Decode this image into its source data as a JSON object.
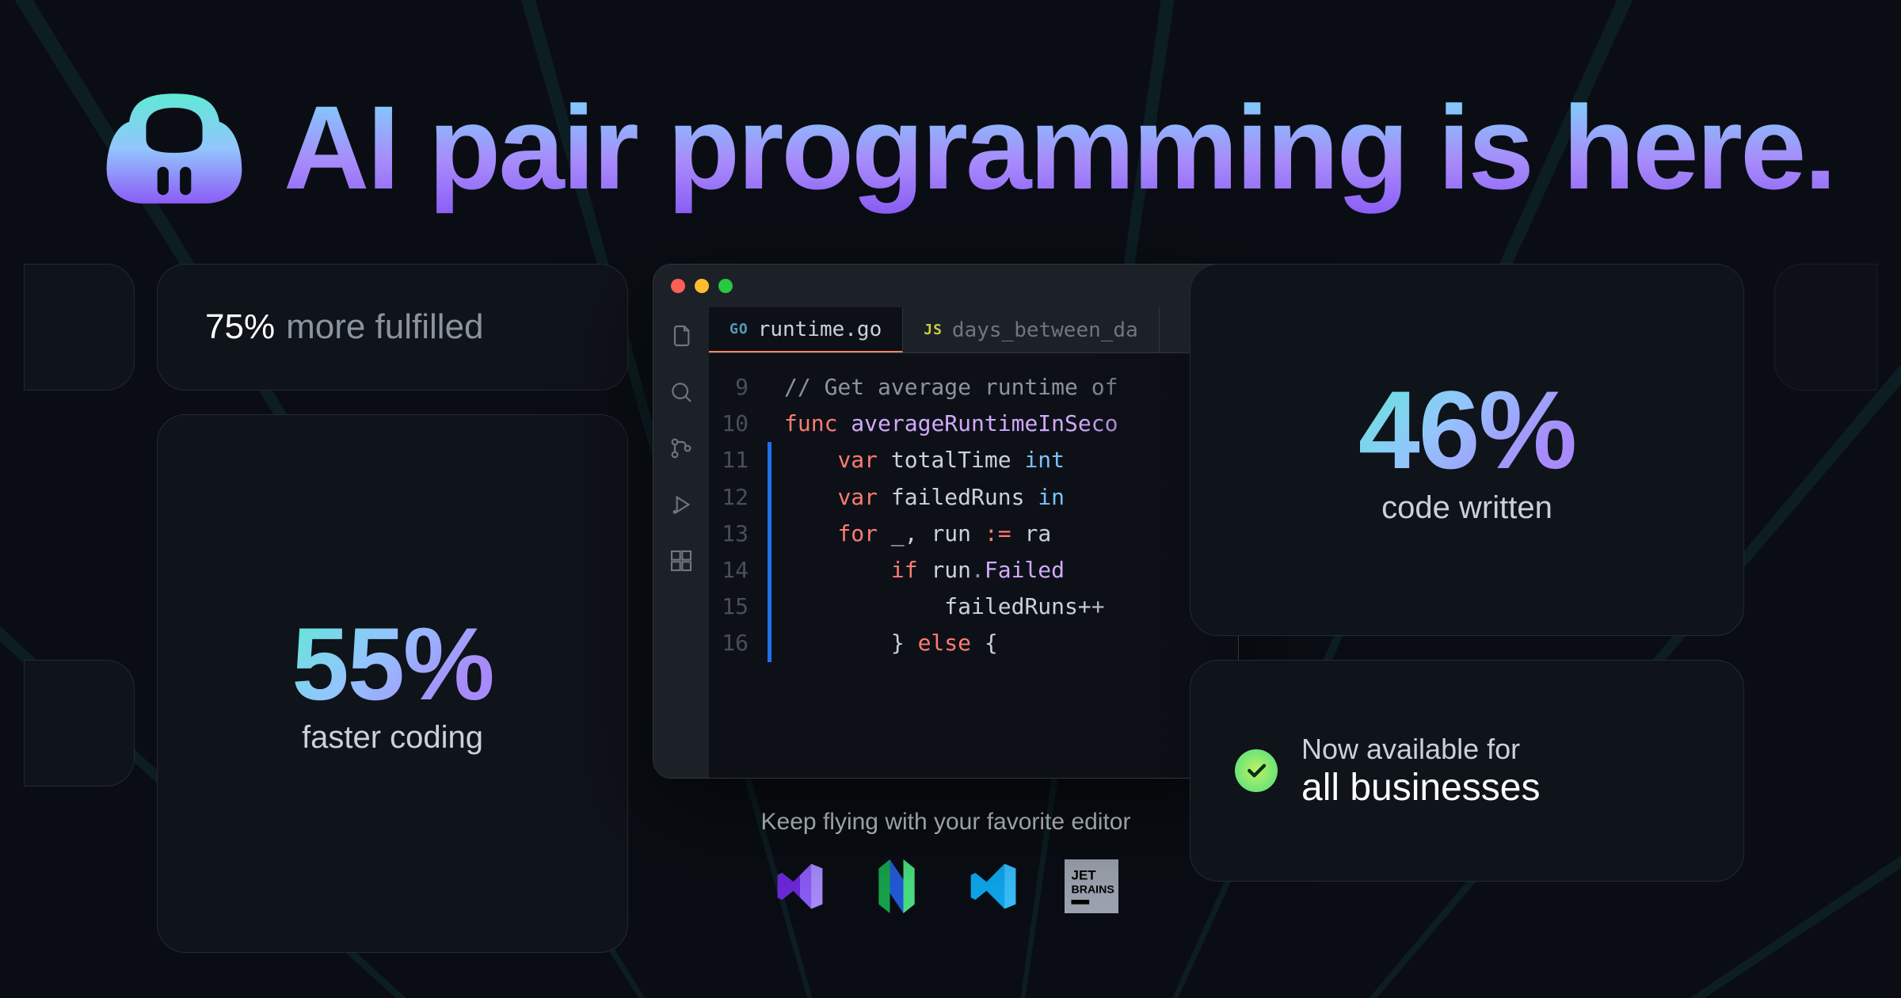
{
  "hero": {
    "title": "AI pair programming is here."
  },
  "cards": {
    "fulfilled": {
      "percent": "75%",
      "label": "more fulfilled"
    },
    "faster": {
      "percent": "55%",
      "label": "faster coding"
    },
    "code_written": {
      "percent": "46%",
      "label": "code written"
    },
    "available": {
      "line1": "Now available for",
      "line2": "all businesses"
    }
  },
  "editor": {
    "tabs": [
      {
        "lang": "GO",
        "name": "runtime.go",
        "active": true
      },
      {
        "lang": "JS",
        "name": "days_between_da",
        "active": false
      }
    ],
    "lines": [
      {
        "n": "9",
        "bar": false,
        "html": "<span class='c-comment'>// Get average runtime of</span>"
      },
      {
        "n": "10",
        "bar": false,
        "html": "<span class='c-key'>func</span> <span class='c-fn'>averageRuntimeInSeco</span>"
      },
      {
        "n": "11",
        "bar": true,
        "html": "&nbsp;&nbsp;&nbsp;&nbsp;<span class='c-key'>var</span> <span class='c-plain'>totalTime</span> <span class='c-prop'>int</span>"
      },
      {
        "n": "12",
        "bar": true,
        "html": "&nbsp;&nbsp;&nbsp;&nbsp;<span class='c-key'>var</span> <span class='c-plain'>failedRuns</span> <span class='c-prop'>in</span>"
      },
      {
        "n": "13",
        "bar": true,
        "html": "&nbsp;&nbsp;&nbsp;&nbsp;<span class='c-key'>for</span> <span class='c-plain'>_, run</span> <span class='c-key'>:=</span> <span class='c-plain'>ra</span>"
      },
      {
        "n": "14",
        "bar": true,
        "html": "&nbsp;&nbsp;&nbsp;&nbsp;&nbsp;&nbsp;&nbsp;&nbsp;<span class='c-key'>if</span> <span class='c-plain'>run</span><span class='c-comment'>.</span><span class='c-fn'>Failed</span>"
      },
      {
        "n": "15",
        "bar": true,
        "html": "&nbsp;&nbsp;&nbsp;&nbsp;&nbsp;&nbsp;&nbsp;&nbsp;&nbsp;&nbsp;&nbsp;&nbsp;<span class='c-plain'>failedRuns++</span>"
      },
      {
        "n": "16",
        "bar": true,
        "html": "&nbsp;&nbsp;&nbsp;&nbsp;&nbsp;&nbsp;&nbsp;&nbsp;<span class='c-plain'>}</span> <span class='c-key'>else</span> <span class='c-plain'>{</span>"
      }
    ]
  },
  "editors_section": {
    "label": "Keep flying with your favorite editor",
    "logos": [
      "visual-studio",
      "neovim",
      "vscode",
      "jetbrains"
    ]
  }
}
